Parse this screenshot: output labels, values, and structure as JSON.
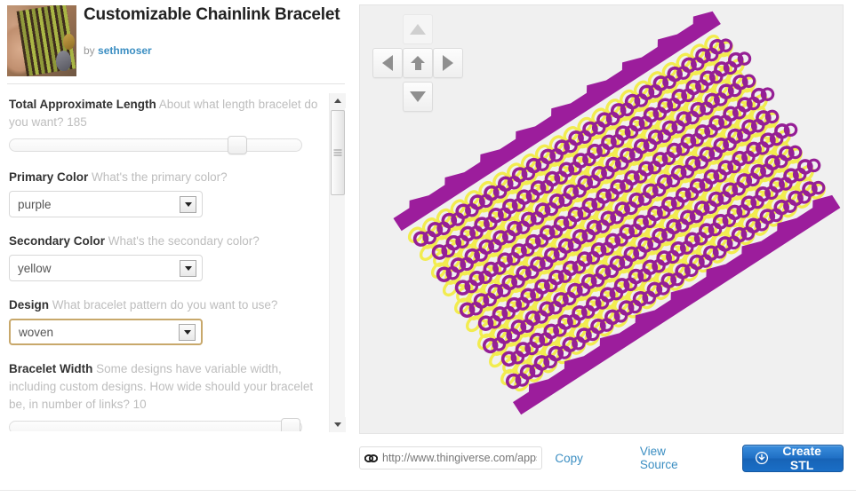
{
  "thing": {
    "title": "Customizable Chainlink Bracelet",
    "by_prefix": "by",
    "author": "sethmoser",
    "thumbnail_alt": "chainmail-bracelet-photo"
  },
  "form": {
    "fields": [
      {
        "id": "total-approximate-length",
        "label": "Total Approximate Length",
        "description": "About what length bracelet do you want? 185",
        "control": "slider",
        "value": 185,
        "handle_percent": 78
      },
      {
        "id": "primary-color",
        "label": "Primary Color",
        "description": "What's the primary color?",
        "control": "select",
        "value": "purple",
        "focused": false
      },
      {
        "id": "secondary-color",
        "label": "Secondary Color",
        "description": "What's the secondary color?",
        "control": "select",
        "value": "yellow",
        "focused": false
      },
      {
        "id": "design",
        "label": "Design",
        "description": "What bracelet pattern do you want to use?",
        "control": "select",
        "value": "woven",
        "focused": true
      },
      {
        "id": "bracelet-width",
        "label": "Bracelet Width",
        "description": "Some designs have variable width, including custom designs. How wide should your bracelet be, in number of links? 10",
        "control": "slider",
        "value": 10,
        "handle_percent": 96
      }
    ]
  },
  "viewer": {
    "nav": {
      "up_icon": "triangle-up-icon",
      "left_icon": "triangle-left-icon",
      "home_icon": "home-arrow-icon",
      "right_icon": "triangle-right-icon",
      "down_icon": "triangle-down-icon"
    },
    "model": {
      "name": "chainlink-bracelet-3d-model",
      "primary_color": "#951f95",
      "secondary_color": "#f2ec4f",
      "background": "#f0f0f0",
      "clasp_color": "#9c1d9c",
      "rows": 9,
      "cols": 22,
      "rotation_deg": -33
    }
  },
  "bottom_bar": {
    "link_icon": "chain-link-icon",
    "url": "http://www.thingiverse.com/apps",
    "copy_label": "Copy",
    "view_source_label": "View Source",
    "create_stl_label": "Create STL",
    "create_stl_icon": "download-circle-icon",
    "accent_color": "#3b8ec2",
    "button_color": "#1f6fc4"
  }
}
